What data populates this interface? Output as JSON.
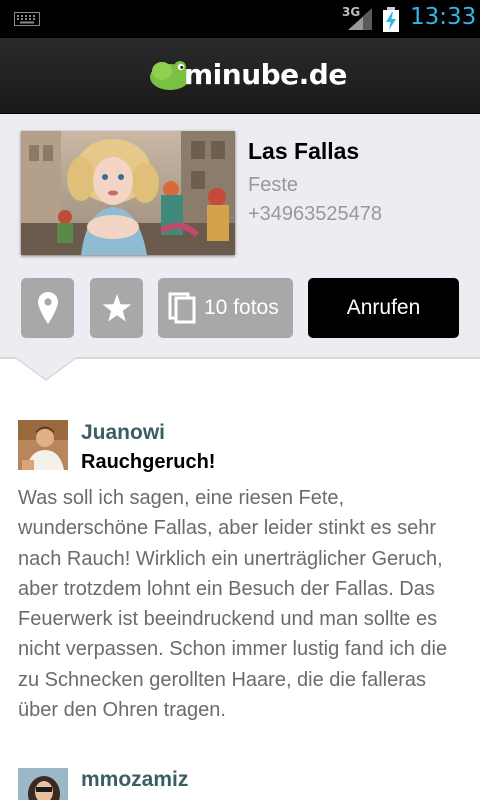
{
  "status_bar": {
    "network": "3G",
    "time": "13:33",
    "icons": [
      "keyboard-icon",
      "signal-icon",
      "battery-charging-icon"
    ],
    "clock_color": "#33b5e5"
  },
  "app_bar": {
    "logo_text": "minube.de",
    "logo_color": "#7ac143"
  },
  "place": {
    "name": "Las Fallas",
    "category": "Feste",
    "phone": "+34963525478"
  },
  "actions": {
    "map_icon": "location-pin-icon",
    "favorite_icon": "star-icon",
    "photos_label": "10 fotos",
    "call_label": "Anrufen"
  },
  "reviews": [
    {
      "author": "Juanowi",
      "title": "Rauchgeruch!",
      "body": "Was soll ich sagen, eine riesen Fete, wunderschöne Fallas, aber leider stinkt es sehr nach Rauch! Wirklich ein unerträglicher Geruch, aber trotzdem lohnt ein Besuch der Fallas. Das Feuerwerk ist beeindruckend und man sollte es nicht verpassen. Schon immer lustig fand ich die zu Schnecken gerollten Haare, die die falleras über den Ohren tragen."
    },
    {
      "author": "mmozamiz"
    }
  ]
}
